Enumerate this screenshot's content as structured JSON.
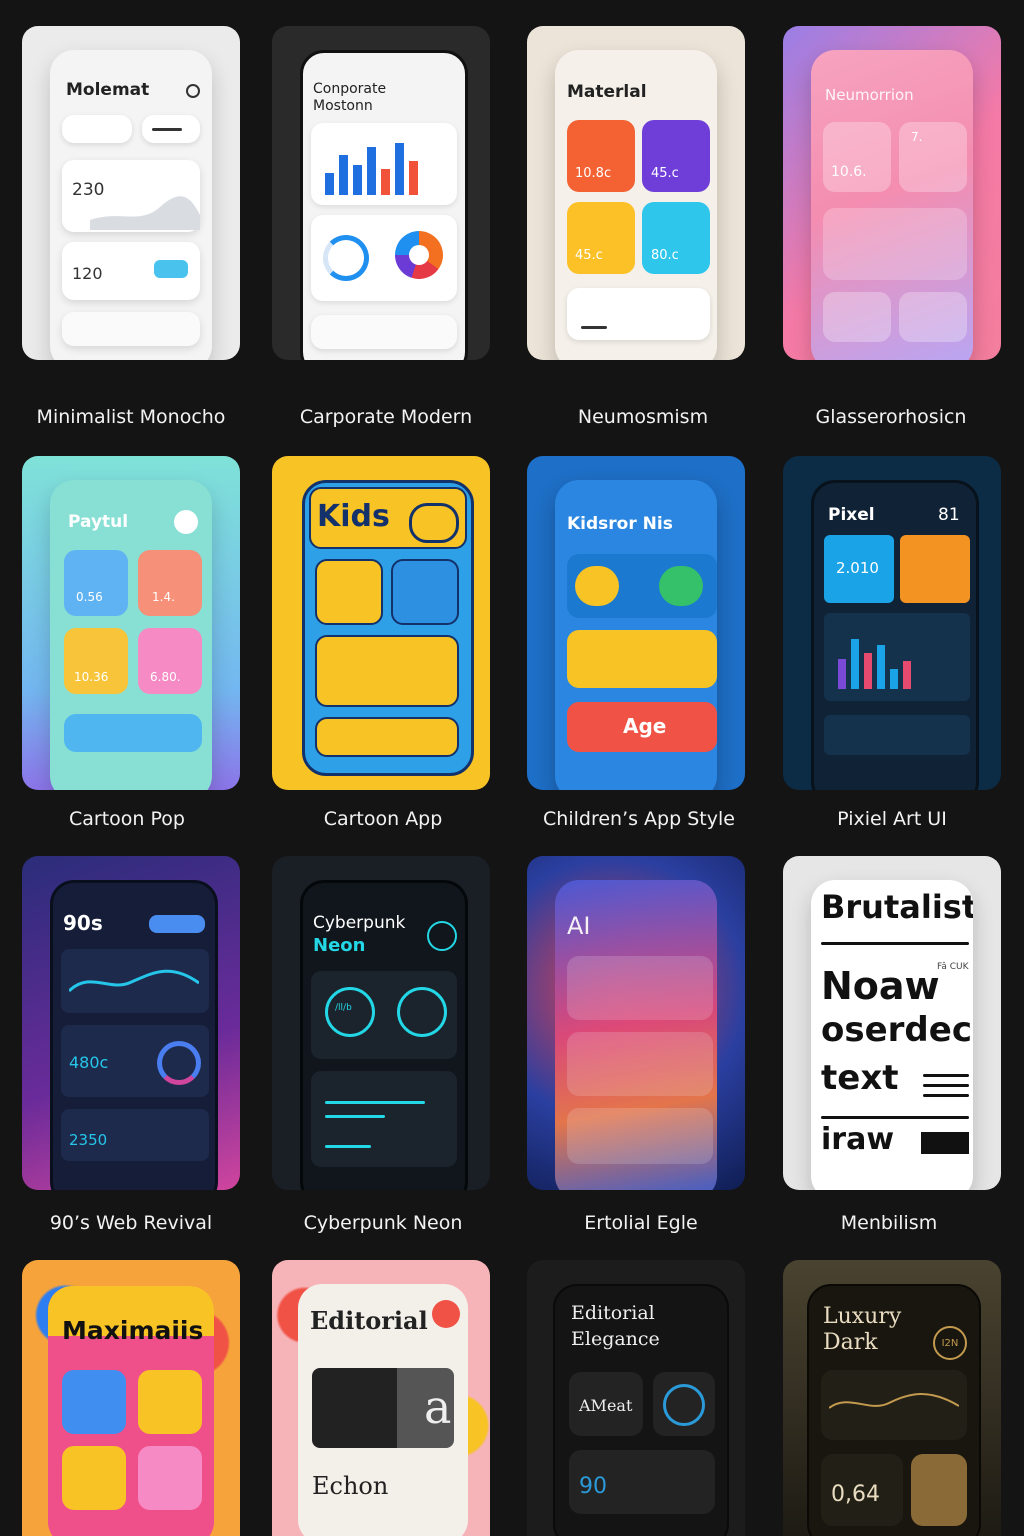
{
  "captions": [
    "Minimalist Monocho",
    "Carporate Modern",
    "Neumosmism",
    "Glasserorhosicn",
    "Cartoon Pop",
    "Cartoon App",
    "Children’s App Style",
    "Pixiel Art UI",
    "90’s Web Revival",
    "Cyberpunk Neon",
    "Ertolial Egle",
    "Menbilism"
  ],
  "c1": {
    "title": "Molemat",
    "v1": "230",
    "v2": "120"
  },
  "c2": {
    "title1": "Conporate",
    "title2": "Mostonn"
  },
  "c3": {
    "title": "Materlal",
    "t1": "10.8c",
    "t2": "45.c",
    "t3": "45.c",
    "t4": "80.c"
  },
  "c4": {
    "title": "Neumorrion",
    "v1": "10.6.",
    "v2": "7."
  },
  "c5": {
    "title": "Paytul",
    "t1": "0.56",
    "t2": "1.4.",
    "t3": "10.36",
    "t4": "6.80."
  },
  "c6": {
    "title": "Kids"
  },
  "c7": {
    "title": "Kidsror Nis",
    "btn": "Age"
  },
  "c8": {
    "title": "Pixel",
    "num": "81",
    "val": "2.010"
  },
  "c9": {
    "title": "90s",
    "v1": "480c",
    "v2": "2350"
  },
  "c10": {
    "title1": "Cyberpunk",
    "title2": "Neon",
    "ring": "/ll/b"
  },
  "c11": {
    "title": "AI"
  },
  "c12": {
    "t1": "Brutalist",
    "t2": "Noaw",
    "t3": "oserdec",
    "t4": "text",
    "t5": "iraw",
    "small": "Fâ CUK"
  },
  "c13": {
    "title": "Maximaiis"
  },
  "c14": {
    "title": "Editorial",
    "big": "a",
    "word": "Echon"
  },
  "c15": {
    "title1": "Editorial",
    "title2": "Elegance",
    "label": "AMeat",
    "num": "90"
  },
  "c16": {
    "title1": "Luxury",
    "title2": "Dark",
    "badge": "I2N",
    "num": "0,64"
  },
  "colors": {
    "bg": "#141414",
    "neonCyan": "#23d7e6",
    "kidsYellow": "#f7c325",
    "pixelBlue": "#1aa3e6"
  }
}
